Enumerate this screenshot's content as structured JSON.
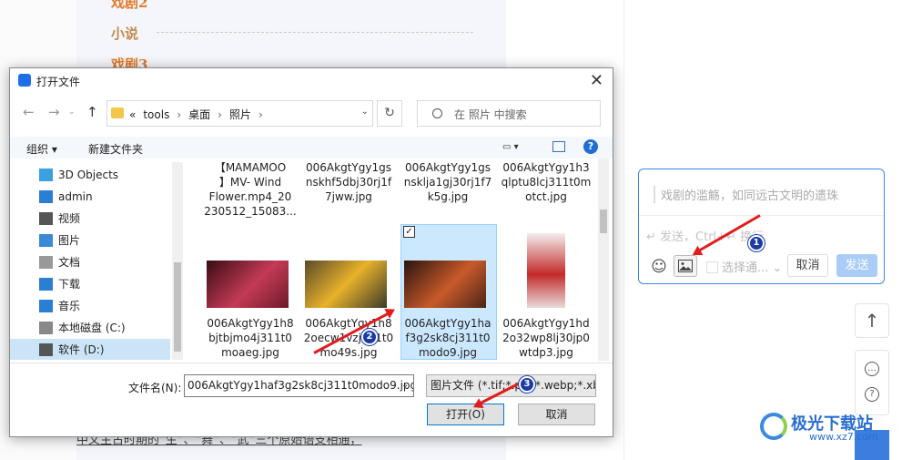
{
  "background": {
    "items": [
      {
        "label": "戏剧2",
        "color": "#e07a2a"
      },
      {
        "label": "小说",
        "color": "#c48a4a"
      },
      {
        "label": "戏剧3",
        "color": "#e07a2a"
      }
    ],
    "bottom_text": "中文主古时期的“生”、“舞”、“武”三个原始语支相通，"
  },
  "comment": {
    "quote": "戏剧的滥觞，如同远古文明的遗珠",
    "placeholder": "↵ 发送，Ctrl+↵ 换行",
    "select_label": "选择通...",
    "cancel_label": "取消",
    "send_label": "发送"
  },
  "dialog": {
    "title": "打开文件",
    "path": [
      "«",
      "tools",
      "桌面",
      "照片"
    ],
    "search_placeholder": "在 照片 中搜索",
    "toolbar": {
      "organize": "组织 ▾",
      "new_folder": "新建文件夹"
    },
    "sidebar": [
      {
        "label": "3D Objects",
        "icon": "cube-icon",
        "color": "#3aa0e0"
      },
      {
        "label": "admin",
        "icon": "monitor-icon",
        "color": "#2a7fd4"
      },
      {
        "label": "视频",
        "icon": "film-icon",
        "color": "#555"
      },
      {
        "label": "图片",
        "icon": "picture-icon",
        "color": "#3b8ad8"
      },
      {
        "label": "文档",
        "icon": "document-icon",
        "color": "#777"
      },
      {
        "label": "下载",
        "icon": "download-icon",
        "color": "#2a7fd4"
      },
      {
        "label": "音乐",
        "icon": "music-icon",
        "color": "#2a7fd4"
      },
      {
        "label": "本地磁盘 (C:)",
        "icon": "drive-icon",
        "color": "#777"
      },
      {
        "label": "软件 (D:)",
        "icon": "drive-icon",
        "color": "#555"
      }
    ],
    "files_top": [
      {
        "name": "【MAMAMOO\n】MV- Wind\nFlower.mp4_20\n230512_15083..."
      },
      {
        "name": "006AkgtYgy1gs\nnskhf5dbj30rj1f\n7jww.jpg"
      },
      {
        "name": "006AkgtYgy1gs\nnsklja1gj30rj1f7\nk5g.jpg"
      },
      {
        "name": "006AkgtYgy1h3\nqlptu8lcj311t0m\notct.jpg"
      }
    ],
    "files_bottom": [
      {
        "name": "006AkgtYgy1h8\nbjtbjmo4j311t0\nmoaeg.jpg",
        "thumb": [
          "#3a0c14",
          "#c43a55",
          "#6b1a2a"
        ]
      },
      {
        "name": "006AkgtYgy1h8\n2oecw1vzj311t0\nmo49s.jpg",
        "thumb": [
          "#5a4a2a",
          "#e8b22a",
          "#3a3a2a"
        ]
      },
      {
        "name": "006AkgtYgy1ha\nf3g2sk8cj311t0\nmodo9.jpg",
        "thumb": [
          "#2a1410",
          "#c85a2a",
          "#4a2418"
        ]
      },
      {
        "name": "006AkgtYgy1hd\n2o32wp8lj30jp0\nwtdp3.jpg",
        "thumb": [
          "#f4eeee",
          "#c42a2a",
          "#e8dada"
        ]
      }
    ],
    "filename_label": "文件名(N):",
    "filename_value": "006AkgtYgy1haf3g2sk8cj311t0modo9.jpg",
    "filetype_value": "图片文件 (*.tif;*.pjp;*.webp;*.xbm",
    "open_label": "打开(O)",
    "cancel_label": "取消"
  },
  "annotations": [
    "1",
    "2",
    "3"
  ],
  "watermark": {
    "text": "极光下载站",
    "url": "www.xz7.com"
  }
}
